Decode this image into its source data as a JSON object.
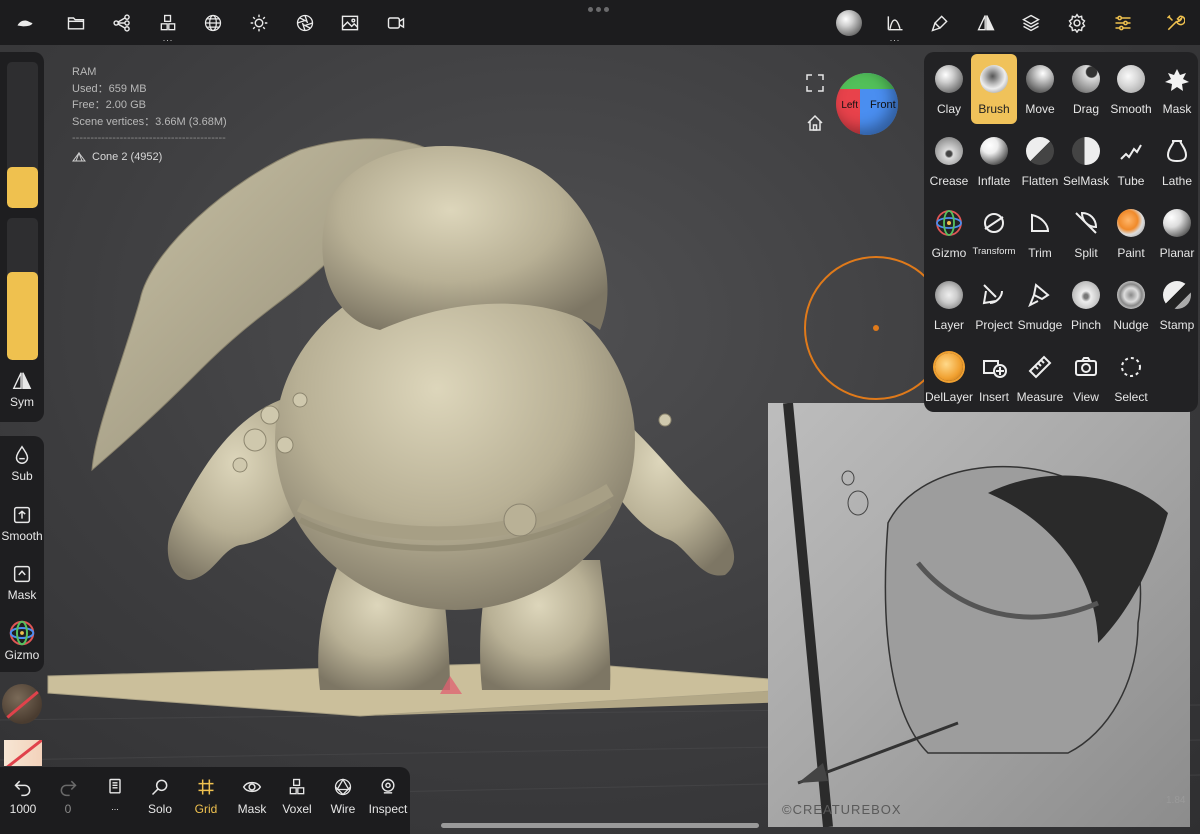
{
  "topbar": {
    "left_icons": [
      "nomad-logo-icon",
      "folder-icon",
      "scene-tree-icon",
      "voxel-cubes-icon",
      "mesh-sphere-icon",
      "light-sun-icon",
      "camera-aperture-icon",
      "image-icon",
      "video-icon"
    ],
    "right_icons": [
      "material-sphere-icon",
      "stroke-curve-icon",
      "paint-brush-icon",
      "symmetry-icon",
      "layers-icon",
      "settings-icon",
      "tool-settings-icon",
      "wrench-icon"
    ]
  },
  "info": {
    "ram_label": "RAM",
    "used": "Used：659 MB",
    "free": "Free：2.00 GB",
    "vertices": "Scene vertices：3.66M (3.68M)",
    "separator": "------------------------------------------",
    "object": "Cone 2 (4952)"
  },
  "orientation": {
    "left_label": "Left",
    "front_label": "Front"
  },
  "left_rail": {
    "sym": "Sym",
    "sub": "Sub",
    "smooth": "Smooth",
    "mask": "Mask",
    "gizmo": "Gizmo",
    "radius_level": 0.28,
    "intensity_level": 0.62
  },
  "tools": [
    {
      "label": "Clay",
      "selected": false
    },
    {
      "label": "Brush",
      "selected": true
    },
    {
      "label": "Move",
      "selected": false
    },
    {
      "label": "Drag",
      "selected": false
    },
    {
      "label": "Smooth",
      "selected": false
    },
    {
      "label": "Mask",
      "selected": false
    },
    {
      "label": "Crease",
      "selected": false
    },
    {
      "label": "Inflate",
      "selected": false
    },
    {
      "label": "Flatten",
      "selected": false
    },
    {
      "label": "SelMask",
      "selected": false
    },
    {
      "label": "Tube",
      "selected": false
    },
    {
      "label": "Lathe",
      "selected": false
    },
    {
      "label": "Gizmo",
      "selected": false
    },
    {
      "label": "Transform",
      "selected": false
    },
    {
      "label": "Trim",
      "selected": false
    },
    {
      "label": "Split",
      "selected": false
    },
    {
      "label": "Paint",
      "selected": false
    },
    {
      "label": "Planar",
      "selected": false
    },
    {
      "label": "Layer",
      "selected": false
    },
    {
      "label": "Project",
      "selected": false
    },
    {
      "label": "Smudge",
      "selected": false
    },
    {
      "label": "Pinch",
      "selected": false
    },
    {
      "label": "Nudge",
      "selected": false
    },
    {
      "label": "Stamp",
      "selected": false
    },
    {
      "label": "DelLayer",
      "selected": false
    },
    {
      "label": "Insert",
      "selected": false
    },
    {
      "label": "Measure",
      "selected": false
    },
    {
      "label": "View",
      "selected": false
    },
    {
      "label": "Select",
      "selected": false
    }
  ],
  "bottombar": {
    "undo_count": "1000",
    "redo_count": "0",
    "solo": "Solo",
    "grid": "Grid",
    "mask": "Mask",
    "voxel": "Voxel",
    "wire": "Wire",
    "inspect": "Inspect"
  },
  "reference": {
    "watermark": "©CREATUREBOX"
  },
  "version": "1.84",
  "colors": {
    "accent": "#efc14f",
    "brush_ring": "#e07a1a",
    "model": "#c9c2a5"
  }
}
